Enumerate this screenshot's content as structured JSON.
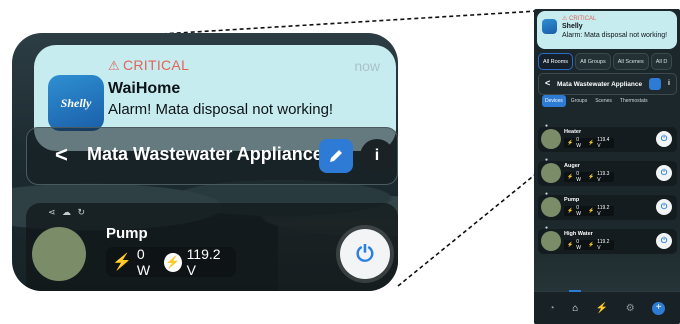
{
  "notification": {
    "level": "CRITICAL",
    "time": "now",
    "app_name": "WaiHome",
    "message": "Alarm! Mata disposal not working!",
    "logo_text": "Shelly"
  },
  "phone_notification": {
    "level": "CRITICAL",
    "app_name": "Shelly",
    "message": "Alarm: Mata disposal not working!"
  },
  "tabs": [
    {
      "label": "All Rooms",
      "active": true
    },
    {
      "label": "All Groups",
      "active": false
    },
    {
      "label": "All Scenes",
      "active": false
    },
    {
      "label": "All D",
      "active": false
    }
  ],
  "header": {
    "back_icon": "chevron-left-icon",
    "title": "Mata Wastewater Appliance",
    "edit_icon": "pencil-icon",
    "info_icon": "info-icon",
    "info_glyph": "i"
  },
  "subtabs": [
    {
      "label": "Devices",
      "active": true
    },
    {
      "label": "Groups",
      "active": false
    },
    {
      "label": "Scenes",
      "active": false
    },
    {
      "label": "Thermostats",
      "active": false
    }
  ],
  "zoom_device": {
    "name": "Pump",
    "power": "0 W",
    "voltage": "119.2 V"
  },
  "devices": [
    {
      "name": "Heater",
      "power": "0 W",
      "voltage": "119.4 V"
    },
    {
      "name": "Auger",
      "power": "0 W",
      "voltage": "119.3 V"
    },
    {
      "name": "Pump",
      "power": "0 W",
      "voltage": "119.2 V"
    },
    {
      "name": "High Water",
      "power": "0 W",
      "voltage": "119.2 V"
    }
  ],
  "nav": [
    "gauge-icon",
    "home-icon",
    "bolt-icon",
    "gear-icon",
    "plus-icon"
  ],
  "colors": {
    "accent": "#2e7bd6",
    "critical": "#e0655a",
    "notification_bg": "#c7ecef",
    "avatar": "#7a8c68"
  }
}
